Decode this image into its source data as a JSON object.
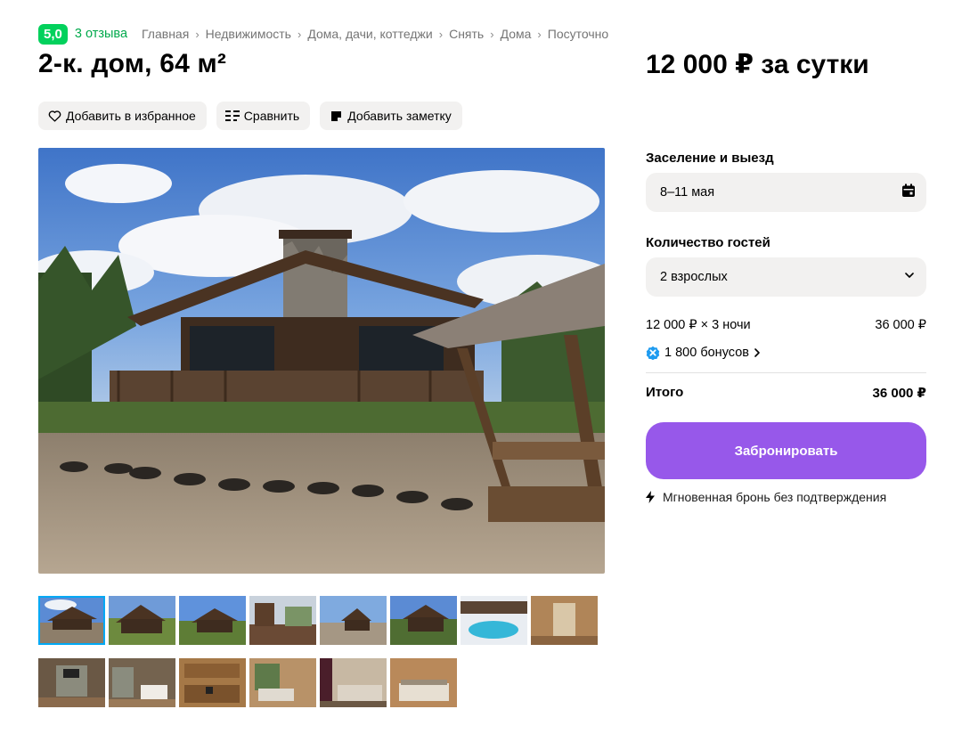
{
  "rating": {
    "score": "5,0",
    "reviews": "3 отзыва"
  },
  "breadcrumbs": [
    "Главная",
    "Недвижимость",
    "Дома, дачи, коттеджи",
    "Снять",
    "Дома",
    "Посуточно"
  ],
  "listing": {
    "title": "2-к. дом, 64 м²",
    "price": "12 000 ₽ за сутки"
  },
  "actions": {
    "favorite": "Добавить в избранное",
    "compare": "Сравнить",
    "note": "Добавить заметку"
  },
  "booking": {
    "dates_label": "Заселение и выезд",
    "dates_value": "8–11 мая",
    "guests_label": "Количество гостей",
    "guests_value": "2 взрослых",
    "calc_label": "12 000 ₽ × 3 ночи",
    "calc_value": "36 000 ₽",
    "bonus": "1 800 бонусов",
    "total_label": "Итого",
    "total_value": "36 000 ₽",
    "book_button": "Забронировать",
    "instant_note": "Мгновенная бронь без подтверждения"
  },
  "gallery": {
    "active_index": 0,
    "thumbnails": [
      "house-exterior",
      "house-exterior",
      "house-exterior",
      "house-terrace",
      "house-exterior",
      "house-exterior",
      "pool-winter",
      "hallway",
      "living-room",
      "living-room",
      "kitchen",
      "bedroom",
      "bedroom",
      "bedroom"
    ]
  },
  "colors": {
    "accent_green": "#02d15c",
    "book_purple": "#9758ea",
    "thumb_active": "#00a9f5",
    "bonus_blue": "#1e9bf0"
  }
}
